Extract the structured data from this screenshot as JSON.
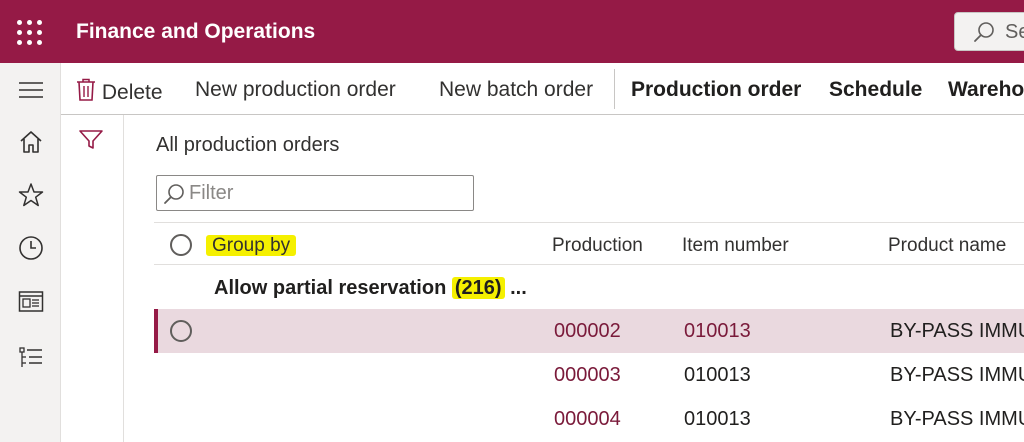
{
  "topbar": {
    "app_title": "Finance and Operations",
    "search_placeholder": "Search",
    "search_visible": "Se",
    "bg_color": "#951a46"
  },
  "leftnav": {
    "items": [
      {
        "name": "hamburger-icon"
      },
      {
        "name": "home-icon"
      },
      {
        "name": "star-icon"
      },
      {
        "name": "clock-icon"
      },
      {
        "name": "workspace-icon"
      },
      {
        "name": "list-icon"
      }
    ]
  },
  "actionpane": {
    "delete": "Delete",
    "new_production_order": "New production order",
    "new_batch_order": "New batch order",
    "production_order": "Production order",
    "schedule": "Schedule",
    "warehouse_visible": "Wareho"
  },
  "page": {
    "title": "All production orders",
    "filter_placeholder": "Filter"
  },
  "grid": {
    "headers": {
      "group_by": "Group by",
      "production": "Production",
      "item_number": "Item number",
      "product_name": "Product name"
    },
    "group": {
      "label_prefix": "Allow partial reservation ",
      "count": "(216)",
      "suffix": " ..."
    },
    "rows": [
      {
        "production": "000002",
        "item_number": "010013",
        "product_name": "BY-PASS IMMU",
        "selected": true
      },
      {
        "production": "000003",
        "item_number": "010013",
        "product_name": "BY-PASS IMMU",
        "selected": false
      },
      {
        "production": "000004",
        "item_number": "010013",
        "product_name": "BY-PASS IMMU",
        "selected": false
      }
    ]
  },
  "colors": {
    "brand": "#951a46",
    "highlight": "#f5f000",
    "link": "#7a1a3a",
    "selected_row": "#ead9df"
  }
}
